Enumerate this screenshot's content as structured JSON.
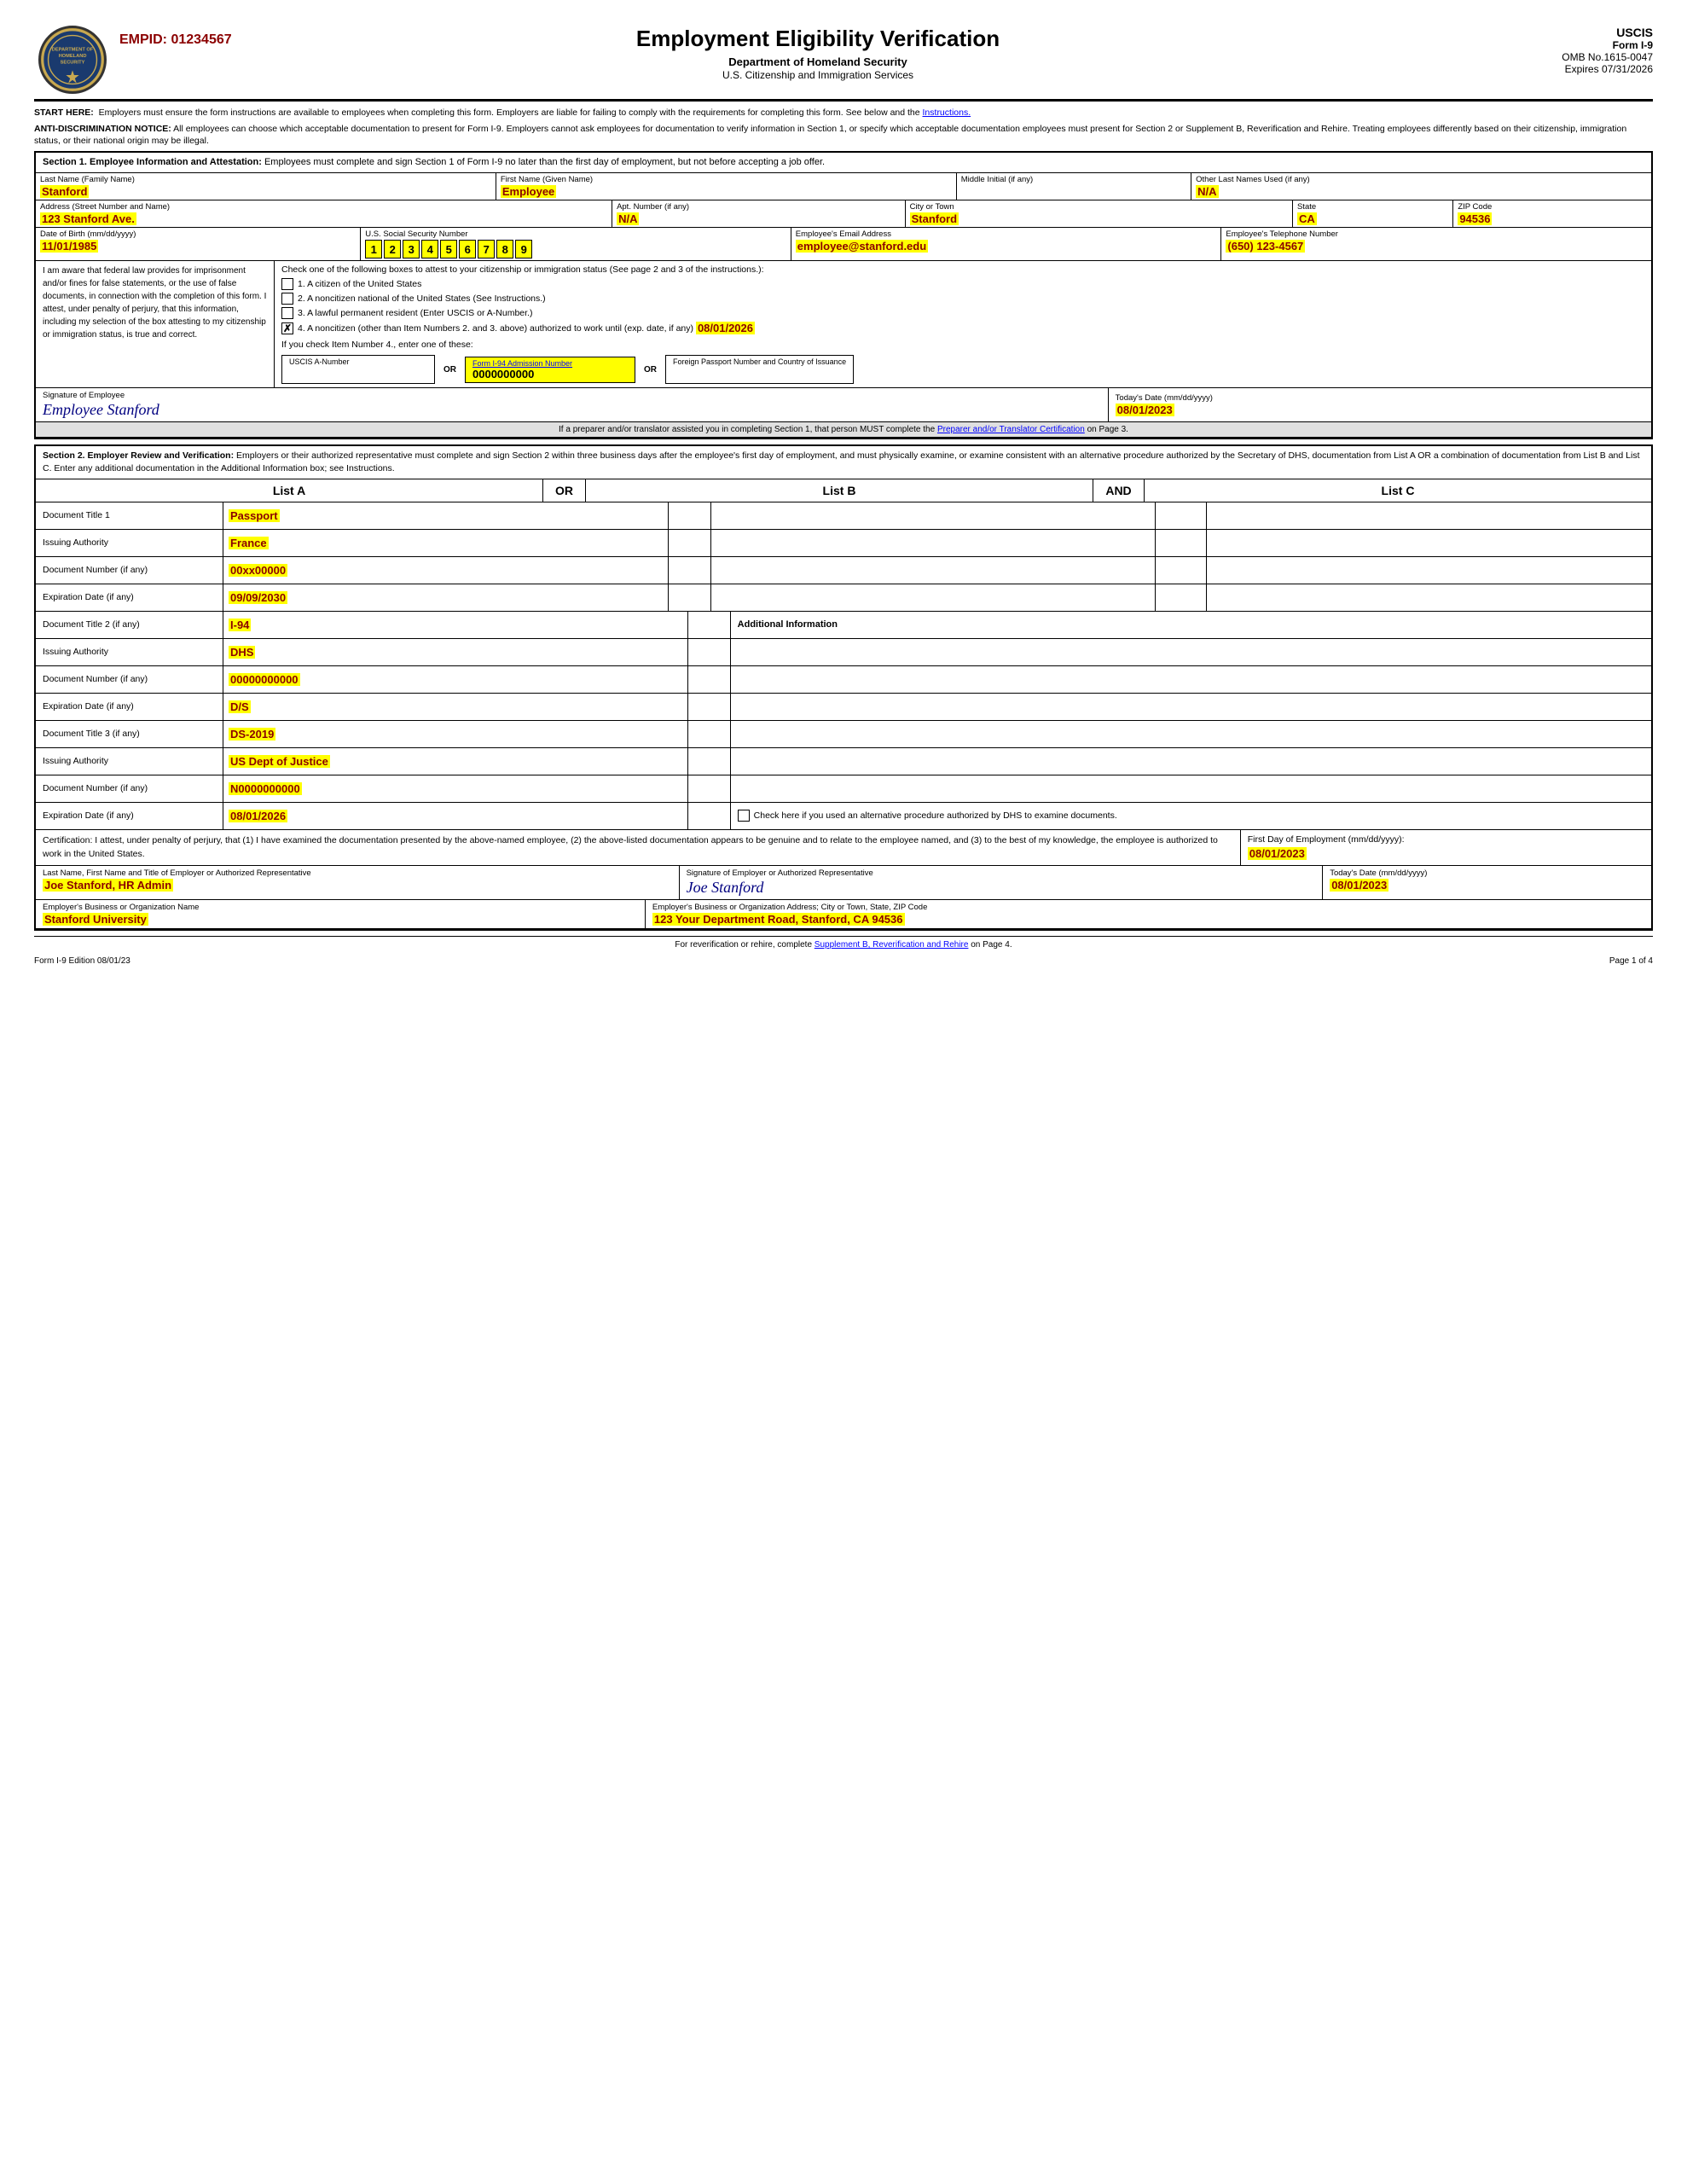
{
  "header": {
    "empid_label": "EMPID: 01234567",
    "form_title": "Employment Eligibility Verification",
    "dept": "Department of Homeland Security",
    "agency": "U.S. Citizenship and Immigration Services",
    "uscis": "USCIS",
    "form_id": "Form I-9",
    "omb": "OMB No.1615-0047",
    "expires": "Expires 07/31/2026"
  },
  "notices": {
    "start_here": "START HERE:  Employers must ensure the form instructions are available to employees when completing this form.  Employers are liable for failing to comply with the requirements for completing this form.  See below and the Instructions.",
    "anti_disc": "ANTI-DISCRIMINATION NOTICE:",
    "anti_disc_text": " All employees can choose which acceptable documentation to present for Form I-9.  Employers cannot ask employees for documentation to verify information in Section 1, or specify which acceptable documentation employees must present for Section 2 or Supplement B, Reverification and Rehire.  Treating employees differently based on their citizenship, immigration status, or their national origin may be illegal."
  },
  "section1": {
    "title": "Section 1. Employee Information and Attestation:",
    "title_text": " Employees must complete and sign Section 1 of Form I-9 no later than the first day of employment, but not before accepting a job offer.",
    "last_name_label": "Last Name (Family Name)",
    "last_name": "Stanford",
    "first_name_label": "First Name (Given Name)",
    "first_name": "Employee",
    "middle_initial_label": "Middle Initial (if any)",
    "middle_initial": "",
    "other_names_label": "Other Last Names Used (if any)",
    "other_names": "N/A",
    "address_label": "Address (Street Number and Name)",
    "address": "123 Stanford Ave.",
    "apt_label": "Apt. Number (if any)",
    "apt": "N/A",
    "city_label": "City or Town",
    "city": "Stanford",
    "state_label": "State",
    "state": "CA",
    "zip_label": "ZIP Code",
    "zip": "94536",
    "dob_label": "Date of Birth (mm/dd/yyyy)",
    "dob": "11/01/1985",
    "ssn_label": "U.S. Social Security Number",
    "ssn_digits": [
      "1",
      "2",
      "3",
      "4",
      "5",
      "6",
      "7",
      "8",
      "9"
    ],
    "email_label": "Employee's Email Address",
    "email": "employee@stanford.edu",
    "phone_label": "Employee's Telephone Number",
    "phone": "(650) 123-4567",
    "attest_text": "I am aware that federal law provides for imprisonment and/or fines for false statements, or the use of false documents, in connection with the completion of this form. I attest, under penalty of perjury, that this information, including my selection of the box attesting to my citizenship or immigration status, is true and correct.",
    "check1": "1.  A citizen of the United States",
    "check2": "2.  A noncitizen national of the United States (See Instructions.)",
    "check3": "3.  A lawful permanent resident (Enter USCIS or A-Number.)",
    "check4": "4.  A noncitizen (other than Item Numbers 2. and 3. above) authorized to work until (exp. date, if any)",
    "check4_date": "08/01/2026",
    "if_check4": "If you check Item Number 4., enter one of these:",
    "uscis_a_label": "USCIS A-Number",
    "or1": "OR",
    "form94_label": "Form I-94 Admission Number",
    "form94_value": "0000000000",
    "or2": "OR",
    "foreign_label": "Foreign Passport Number and Country of Issuance",
    "sig_label": "Signature of Employee",
    "signature": "Employee Stanford",
    "date_label": "Today's Date (mm/dd/yyyy)",
    "date": "08/01/2023",
    "preparer_note": "If a preparer and/or translator assisted you in completing Section 1, that person MUST complete the Preparer and/or Translator Certification on Page 3."
  },
  "section2": {
    "title": "Section 2. Employer Review and Verification:",
    "title_text": " Employers or their authorized representative must complete and sign Section 2 within three business days after the employee's first day of employment, and must physically examine, or examine consistent with an alternative procedure authorized by the Secretary of DHS, documentation from List A OR a combination of documentation from List B and List C.  Enter any additional documentation in the Additional Information box; see Instructions.",
    "list_a": "List A",
    "or_label": "OR",
    "list_b": "List B",
    "and_label": "AND",
    "list_c": "List C",
    "doc1_title_label": "Document Title 1",
    "doc1_title": "Passport",
    "doc1_issuing_label": "Issuing Authority",
    "doc1_issuing": "France",
    "doc1_number_label": "Document Number (if any)",
    "doc1_number": "00xx00000",
    "doc1_expiry_label": "Expiration Date (if any)",
    "doc1_expiry": "09/09/2030",
    "doc2_title_label": "Document Title 2 (if any)",
    "doc2_title": "I-94",
    "additional_info_label": "Additional Information",
    "doc2_issuing_label": "Issuing Authority",
    "doc2_issuing": "DHS",
    "doc2_number_label": "Document Number (if any)",
    "doc2_number": "00000000000",
    "doc2_expiry_label": "Expiration Date (if any)",
    "doc2_expiry": "D/S",
    "doc3_title_label": "Document Title 3 (if any)",
    "doc3_title": "DS-2019",
    "doc3_issuing_label": "Issuing Authority",
    "doc3_issuing": "US Dept of Justice",
    "doc3_number_label": "Document Number (if any)",
    "doc3_number": "N0000000000",
    "doc3_expiry_label": "Expiration Date (if any)",
    "doc3_expiry": "08/01/2026",
    "alt_proc_label": "Check here if you used an alternative procedure authorized by DHS to examine documents.",
    "cert_text": "Certification: I attest, under penalty of perjury, that (1) I have examined the documentation presented by the above-named employee, (2) the above-listed documentation appears to be genuine and to relate to the employee named, and (3) to the best of my knowledge, the employee is authorized to work in the United States.",
    "first_day_label": "First Day of Employment (mm/dd/yyyy):",
    "first_day": "08/01/2023",
    "employer_name_label": "Last Name, First Name and Title of Employer or Authorized Representative",
    "employer_name": "Joe Stanford, HR Admin",
    "sig2_label": "Signature of Employer or Authorized Representative",
    "sig2": "Joe Stanford",
    "date2_label": "Today's Date (mm/dd/yyyy)",
    "date2": "08/01/2023",
    "org_name_label": "Employer's Business or Organization Name",
    "org_name": "Stanford University",
    "org_address_label": "Employer's Business or Organization Address; City or Town, State, ZIP Code",
    "org_address": "123 Your Department Road, Stanford, CA 94536"
  },
  "footer": {
    "rehire_note": "For reverification or rehire, complete Supplement B, Reverification and Rehire on Page 4.",
    "form_edition": "Form I-9  Edition  08/01/23",
    "page": "Page 1 of 4"
  }
}
